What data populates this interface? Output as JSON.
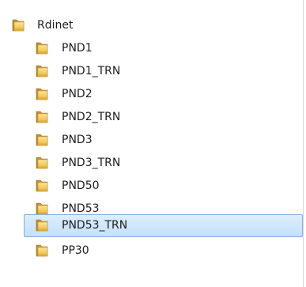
{
  "tree": {
    "root": {
      "label": "Rdinet",
      "icon": "folder-icon"
    },
    "items": [
      {
        "label": "PND1",
        "icon": "folder-icon",
        "selected": false
      },
      {
        "label": "PND1_TRN",
        "icon": "folder-icon",
        "selected": false
      },
      {
        "label": "PND2",
        "icon": "folder-icon",
        "selected": false
      },
      {
        "label": "PND2_TRN",
        "icon": "folder-icon",
        "selected": false
      },
      {
        "label": "PND3",
        "icon": "folder-icon",
        "selected": false
      },
      {
        "label": "PND3_TRN",
        "icon": "folder-icon",
        "selected": false
      },
      {
        "label": "PND50",
        "icon": "folder-icon",
        "selected": false
      },
      {
        "label": "PND53",
        "icon": "folder-icon",
        "selected": false
      },
      {
        "label": "PND53_TRN",
        "icon": "folder-icon",
        "selected": true
      },
      {
        "label": "PP30",
        "icon": "folder-icon",
        "selected": false
      }
    ]
  },
  "colors": {
    "selection_fill": "#cde6fb",
    "selection_border": "#84acdd",
    "folder_body": "#f2c44f",
    "folder_shadow": "#c9952a"
  }
}
